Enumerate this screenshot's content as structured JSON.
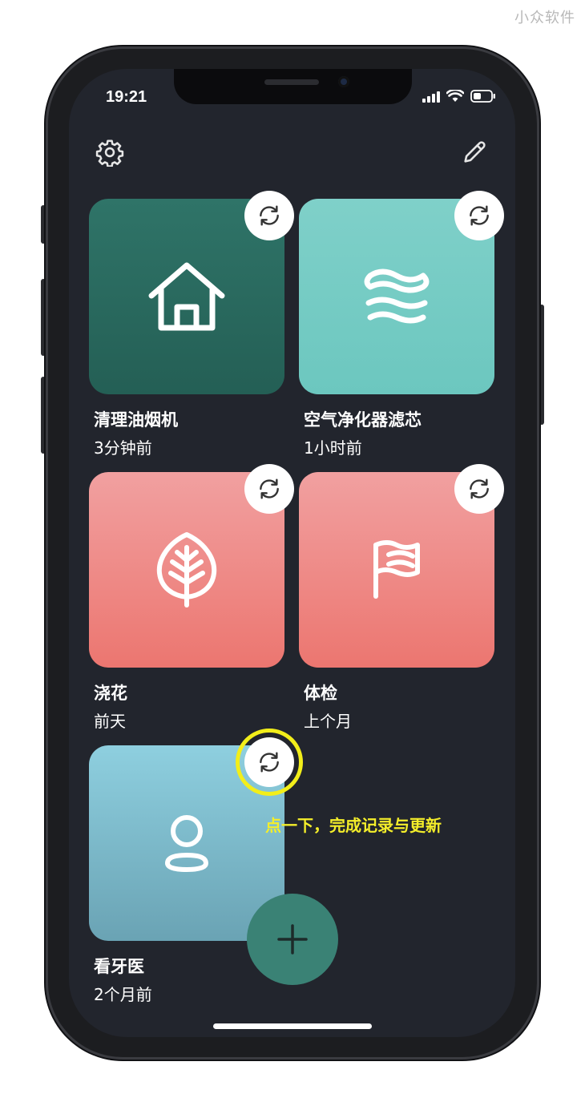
{
  "watermark": "小众软件",
  "status_bar": {
    "time": "19:21"
  },
  "toolbar": {
    "settings_icon": "gear-icon",
    "edit_icon": "pencil-icon"
  },
  "cards": [
    {
      "title": "清理油烟机",
      "subtitle": "3分钟前",
      "icon": "house-icon",
      "color": "#2f7468"
    },
    {
      "title": "空气净化器滤芯",
      "subtitle": "1小时前",
      "icon": "waves-icon",
      "color": "#7fd0c9"
    },
    {
      "title": "浇花",
      "subtitle": "前天",
      "icon": "leaf-icon",
      "color": "#ee8680"
    },
    {
      "title": "体检",
      "subtitle": "上个月",
      "icon": "flag-icon",
      "color": "#ee8680"
    },
    {
      "title": "看牙医",
      "subtitle": "2个月前",
      "icon": "person-icon",
      "color": "#7fbccc"
    }
  ],
  "annotation": "点一下，完成记录与更新",
  "fab": {
    "icon": "plus-icon"
  },
  "colors": {
    "background": "#22252d",
    "highlight": "#f2ee1a",
    "fab": "#3a8275"
  }
}
